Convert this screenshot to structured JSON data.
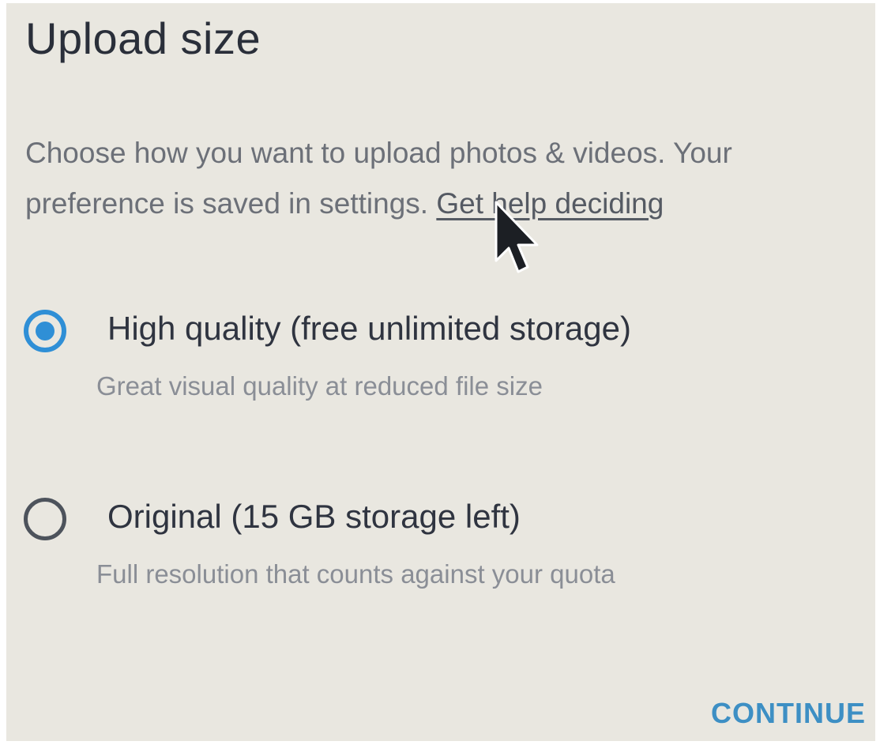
{
  "dialog": {
    "title": "Upload size",
    "description": "Choose how you want to upload photos & videos. Your preference is saved in settings.",
    "help_link": "Get help deciding"
  },
  "options": [
    {
      "label": "High quality (free unlimited storage)",
      "sublabel": "Great visual quality at reduced file size",
      "selected": true
    },
    {
      "label": "Original (15 GB storage left)",
      "sublabel": "Full resolution that counts against your quota",
      "selected": false
    }
  ],
  "actions": {
    "continue_label": "CONTINUE"
  },
  "colors": {
    "accent": "#2f8fd6",
    "continue": "#3d8fc4"
  },
  "icons": {
    "cursor": "mouse-pointer-icon"
  }
}
